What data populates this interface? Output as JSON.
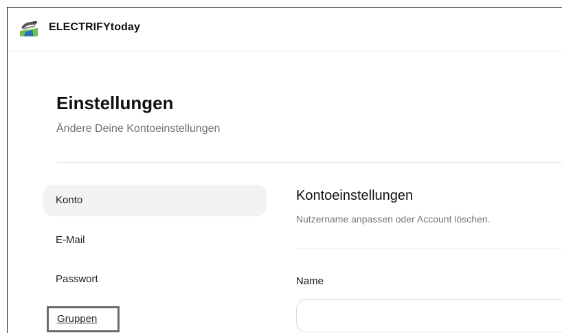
{
  "header": {
    "brand": "ELECTRIFYtoday",
    "logo_icon": "car-road-logo-icon"
  },
  "page": {
    "title": "Einstellungen",
    "subtitle": "Ändere Deine Kontoeinstellungen"
  },
  "sidebar": {
    "items": [
      {
        "label": "Konto",
        "active": true
      },
      {
        "label": "E-Mail",
        "active": false
      },
      {
        "label": "Passwort",
        "active": false
      },
      {
        "label": "Gruppen",
        "active": false,
        "highlighted": true
      }
    ]
  },
  "section": {
    "title": "Kontoeinstellungen",
    "subtitle": "Nutzername anpassen oder Account löschen.",
    "fields": {
      "name": {
        "label": "Name",
        "value": "",
        "placeholder": ""
      }
    }
  },
  "colors": {
    "active_bg": "#f2f2f2",
    "muted_text": "#6f6f6f",
    "divider": "#e5e5e5",
    "highlight_border": "#6a6a6a",
    "logo_green": "#6fbf4b",
    "logo_blue": "#2b6fb8"
  }
}
